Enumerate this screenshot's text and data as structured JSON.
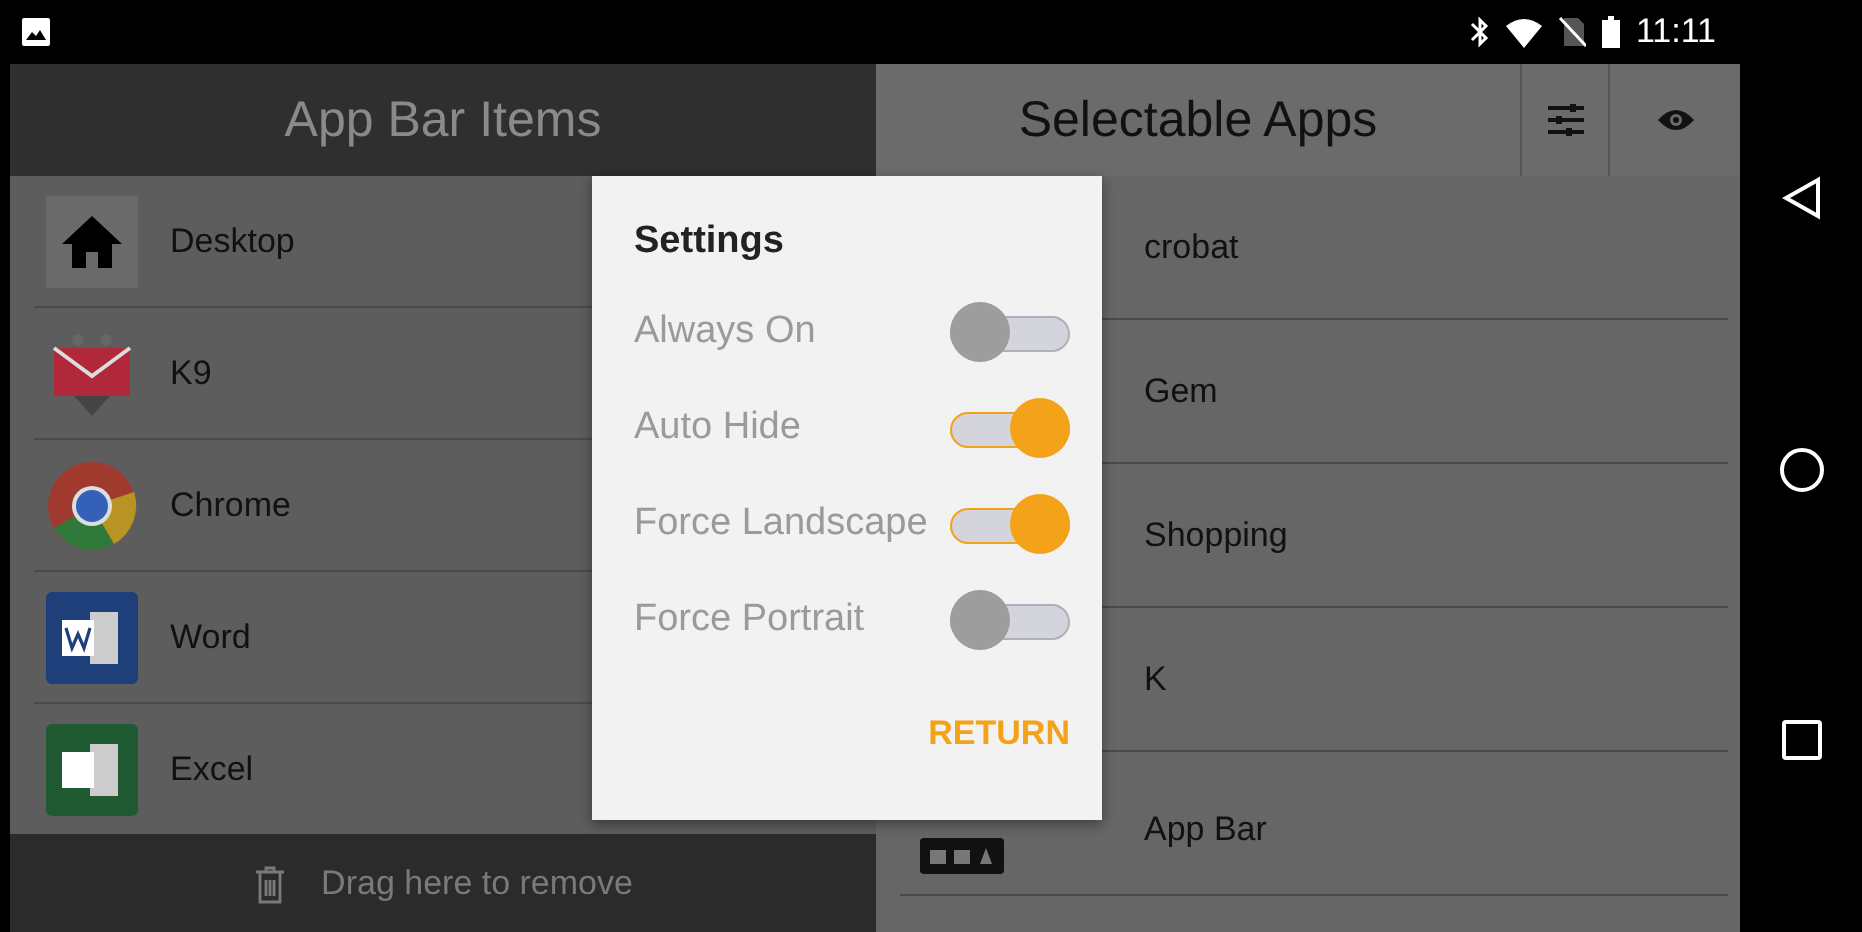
{
  "status_bar": {
    "time": "11:11"
  },
  "left_panel": {
    "title": "App Bar Items",
    "items": [
      {
        "name": "Desktop",
        "kind": "home"
      },
      {
        "name": "K9",
        "kind": "mail"
      },
      {
        "name": "Chrome",
        "kind": "chrome"
      },
      {
        "name": "Word",
        "kind": "word"
      },
      {
        "name": "Excel",
        "kind": "excel"
      }
    ],
    "drag_hint": "Drag here to remove"
  },
  "right_panel": {
    "title": "Selectable Apps",
    "items": [
      {
        "name": "crobat",
        "kind": "covered"
      },
      {
        "name": "Gem",
        "kind": "covered"
      },
      {
        "name": "Shopping",
        "kind": "covered"
      },
      {
        "name": "K",
        "kind": "covered"
      },
      {
        "name": "App Bar",
        "kind": "appbar"
      }
    ]
  },
  "dialog": {
    "title": "Settings",
    "options": [
      {
        "label": "Always On",
        "on": false
      },
      {
        "label": "Auto Hide",
        "on": true
      },
      {
        "label": "Force Landscape",
        "on": true
      },
      {
        "label": "Force Portrait",
        "on": false
      }
    ],
    "button": "RETURN"
  }
}
